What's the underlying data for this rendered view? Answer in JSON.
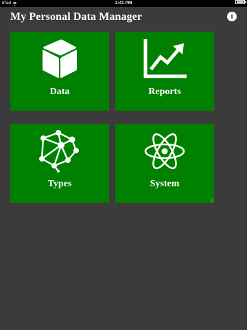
{
  "status_bar": {
    "carrier": "iPad",
    "time": "3:41 PM",
    "battery_level": 0.95
  },
  "header": {
    "title": "My Personal Data Manager",
    "info_icon_glyph": "i"
  },
  "tiles": [
    {
      "label": "Data",
      "icon": "cube-icon"
    },
    {
      "label": "Reports",
      "icon": "line-chart-icon"
    },
    {
      "label": "Types",
      "icon": "molecule-structure-icon"
    },
    {
      "label": "System",
      "icon": "atom-icon"
    }
  ],
  "colors": {
    "background": "#3b3b3b",
    "tile": "#008000",
    "text": "#ffffff"
  }
}
